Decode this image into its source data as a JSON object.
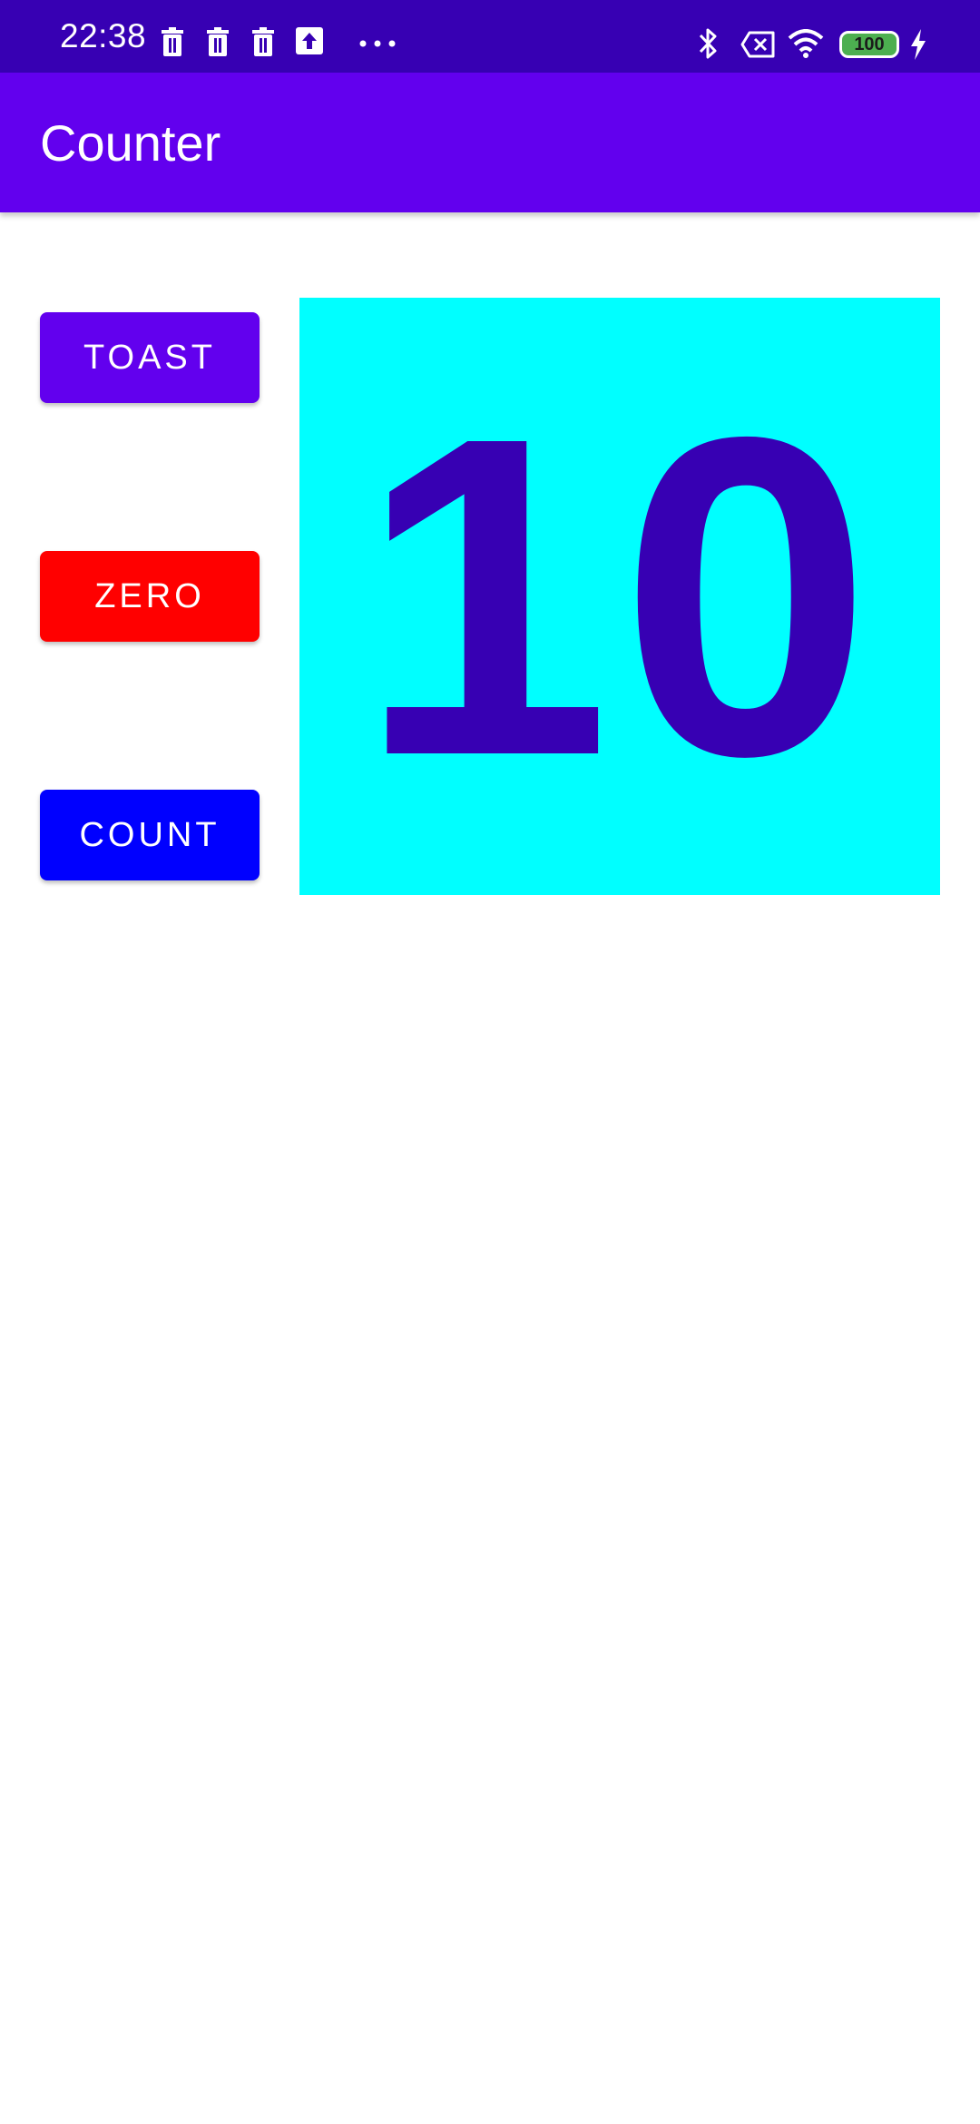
{
  "status_bar": {
    "time": "22:38",
    "battery_level": "100",
    "icons": [
      "trash-icon",
      "trash-icon",
      "trash-icon",
      "upload-icon",
      "more-dots-icon",
      "bluetooth-icon",
      "no-sim-icon",
      "wifi-icon",
      "battery-icon",
      "charging-bolt-icon"
    ],
    "background_color": "#3700b3"
  },
  "app_bar": {
    "title": "Counter",
    "background_color": "#6200ee"
  },
  "buttons": {
    "toast": {
      "label": "TOAST",
      "color": "#6200ee"
    },
    "zero": {
      "label": "ZERO",
      "color": "#ff0000"
    },
    "count": {
      "label": "COUNT",
      "color": "#0000ff"
    }
  },
  "counter": {
    "value": "10",
    "background_color": "#00ffff",
    "text_color": "#3700b3"
  }
}
